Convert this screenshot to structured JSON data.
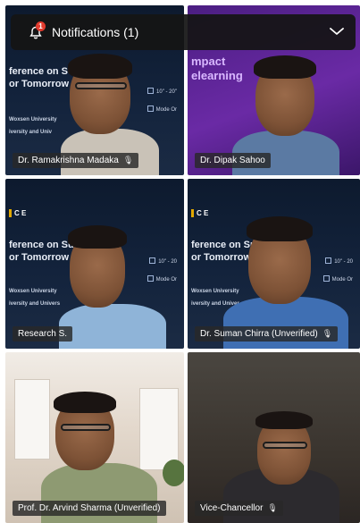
{
  "notifications": {
    "label": "Notifications (1)",
    "count": "1",
    "icons": {
      "bell": "bell-icon",
      "chevron": "chevron-down-icon"
    }
  },
  "tiles": [
    {
      "name": "Dr. Ramakrishna Madaka",
      "muted": true,
      "background": "conference-slide",
      "slide_lines": [
        "ference on S",
        "or Tomorrow"
      ],
      "slide_small": [
        "Woxsen University",
        "iversity and Univ"
      ],
      "slide_info": [
        "10\" - 20\"",
        "Mode Or"
      ]
    },
    {
      "name": "Dr. Dipak Sahoo",
      "muted": false,
      "background": "purple",
      "slide_lines": [
        "mpact",
        "elearning"
      ]
    },
    {
      "name": "Research S.",
      "muted": false,
      "background": "conference-slide",
      "slide_logo": "C E",
      "slide_lines": [
        "ference on Sus",
        "or Tomorrow"
      ],
      "slide_small": [
        "Woxsen University",
        "iversity and Univers"
      ],
      "slide_info": [
        "10\" - 20",
        "Mode Or"
      ]
    },
    {
      "name": "Dr. Suman Chirra (Unverified)",
      "muted": true,
      "background": "conference-slide",
      "slide_logo": "C E",
      "slide_lines": [
        "ference on Sust",
        "or Tomorrow"
      ],
      "slide_small": [
        "Woxsen University",
        "iversity and Univer"
      ],
      "slide_info": [
        "10\" - 20",
        "Mode Or"
      ]
    },
    {
      "name": "Prof. Dr. Arvind Sharma (Unverified)",
      "muted": false,
      "background": "office"
    },
    {
      "name": "Vice-Chancellor",
      "muted": true,
      "background": "dark"
    }
  ],
  "colors": {
    "slide_bg": "#13233c",
    "purple_bg": "#6a2aa5",
    "badge_red": "#e23b2e",
    "name_tag_bg": "#282828"
  }
}
